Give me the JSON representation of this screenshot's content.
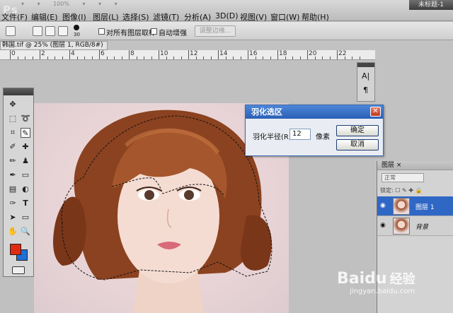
{
  "app": {
    "logo": "Ps",
    "doc_title_tab": "未标题-1"
  },
  "menu": {
    "row1": [
      "▾",
      "▾",
      "100%",
      "▾",
      "▾",
      "▾"
    ],
    "items": [
      "文件(F)",
      "编辑(E)",
      "图像(I)",
      "图层(L)",
      "选择(S)",
      "滤镜(T)",
      "分析(A)",
      "3D(D)",
      "视图(V)",
      "窗口(W)",
      "帮助(H)"
    ]
  },
  "options": {
    "brush_size": "30",
    "sample_all_label": "对所有图层取样",
    "auto_enhance_label": "自动增强",
    "refine_edge_label": "调整边缘..."
  },
  "document": {
    "tab_label": "韩国.tif @ 25% (图层 1, RGB/8#) * ×",
    "ruler_ticks": [
      "0",
      "2",
      "4",
      "6",
      "8",
      "10",
      "12",
      "14",
      "16",
      "18",
      "20",
      "22"
    ]
  },
  "char_panel": {
    "glyph1": "A|",
    "glyph2": "¶"
  },
  "dialog": {
    "title": "羽化选区",
    "radius_label": "羽化半径(R):",
    "radius_value": "12",
    "unit": "像素",
    "ok_label": "确定",
    "cancel_label": "取消",
    "close_glyph": "✕"
  },
  "layers": {
    "tab_label": "图层 ×",
    "blend_mode": "正常",
    "lock_label": "锁定: ☐ ✎ ✚ 🔒",
    "rows": [
      {
        "name": "图层 1",
        "selected": true
      },
      {
        "name": "背景",
        "selected": false
      }
    ]
  },
  "watermark": {
    "brand": "Baidu",
    "sub": "经验",
    "url": "jingyan.baidu.com"
  },
  "colors": {
    "foreground": "#e02a12",
    "background": "#1f6fd6",
    "dialog_title": "#2a5fb5",
    "selected_layer": "#2f67c5"
  }
}
